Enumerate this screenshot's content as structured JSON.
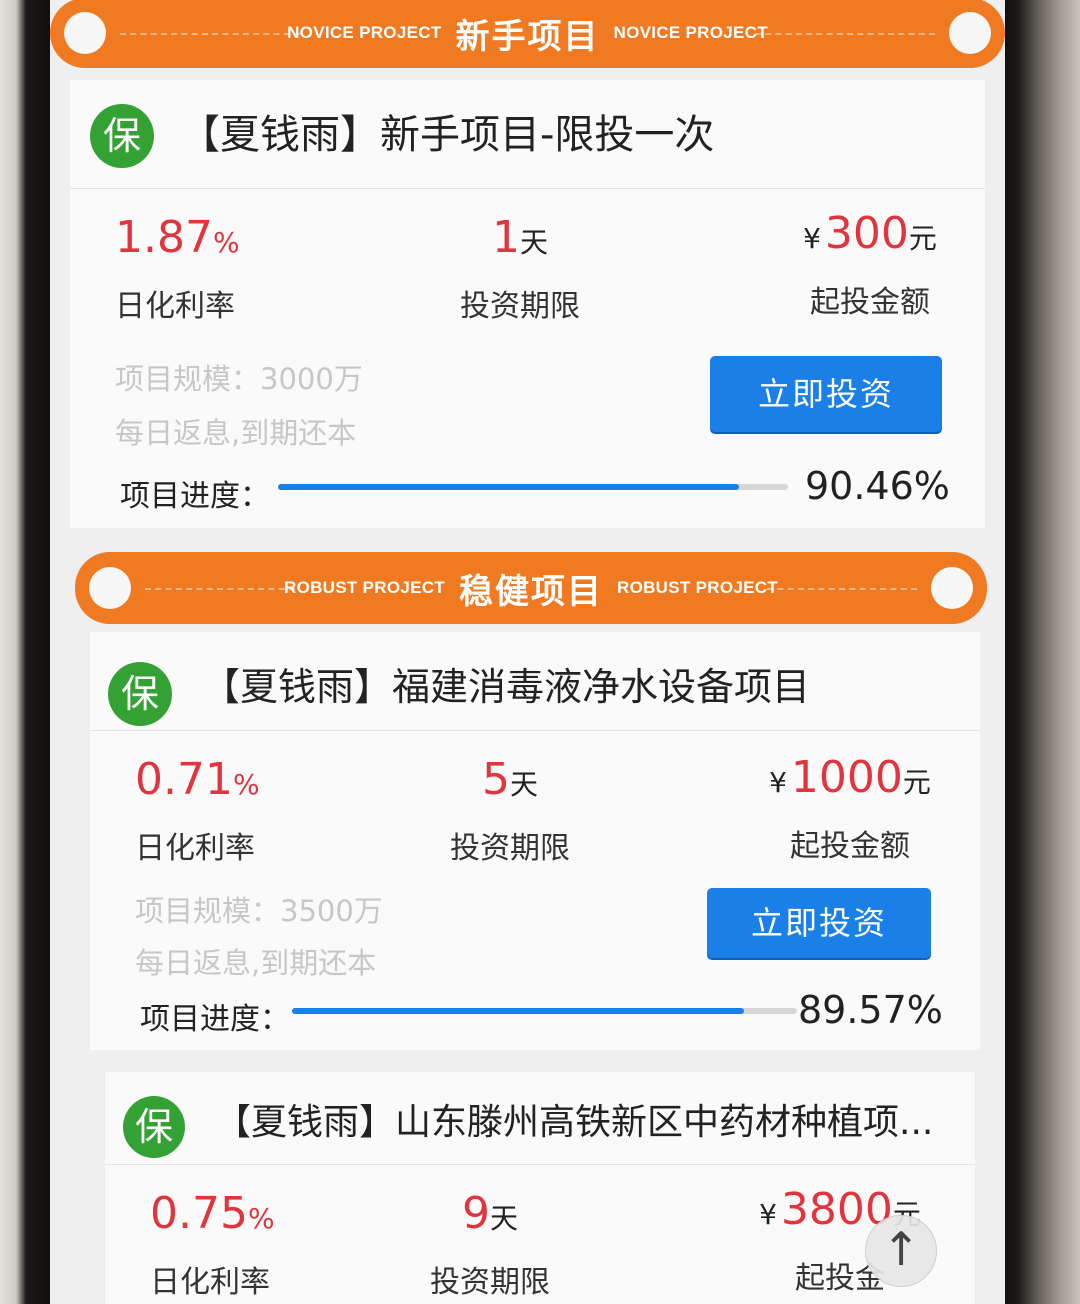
{
  "sections": [
    {
      "sub_left": "NOVICE PROJECT",
      "title": "新手项目",
      "sub_right": "NOVICE PROJECT"
    },
    {
      "sub_left": "ROBUST PROJECT",
      "title": "稳健项目",
      "sub_right": "ROBUST PROJECT"
    }
  ],
  "projects": [
    {
      "badge": "保",
      "title": "【夏钱雨】新手项目-限投一次",
      "rate_value": "1.87",
      "rate_unit": "%",
      "rate_label": "日化利率",
      "term_value": "1",
      "term_unit": "天",
      "term_label": "投资期限",
      "yen": "¥",
      "min_value": "300",
      "min_unit": "元",
      "min_label": "起投金额",
      "scale": "项目规模：3000万",
      "repay": "每日返息,到期还本",
      "invest_button": "立即投资",
      "progress_label": "项目进度：",
      "progress_percent": 90.46,
      "progress_text": "90.46%"
    },
    {
      "badge": "保",
      "title": "【夏钱雨】福建消毒液净水设备项目",
      "rate_value": "0.71",
      "rate_unit": "%",
      "rate_label": "日化利率",
      "term_value": "5",
      "term_unit": "天",
      "term_label": "投资期限",
      "yen": "¥",
      "min_value": "1000",
      "min_unit": "元",
      "min_label": "起投金额",
      "scale": "项目规模：3500万",
      "repay": "每日返息,到期还本",
      "invest_button": "立即投资",
      "progress_label": "项目进度：",
      "progress_percent": 89.57,
      "progress_text": "89.57%"
    },
    {
      "badge": "保",
      "title": "【夏钱雨】山东滕州高铁新区中药材种植项...",
      "rate_value": "0.75",
      "rate_unit": "%",
      "rate_label": "日化利率",
      "term_value": "9",
      "term_unit": "天",
      "term_label": "投资期限",
      "yen": "¥",
      "min_value": "3800",
      "min_unit": "元",
      "min_label": "起投金"
    }
  ],
  "back_to_top": "↑",
  "colors": {
    "accent": "#f07a22",
    "primary": "#1a7fe6",
    "rate_red": "#e0353d",
    "badge_green": "#33a133"
  }
}
